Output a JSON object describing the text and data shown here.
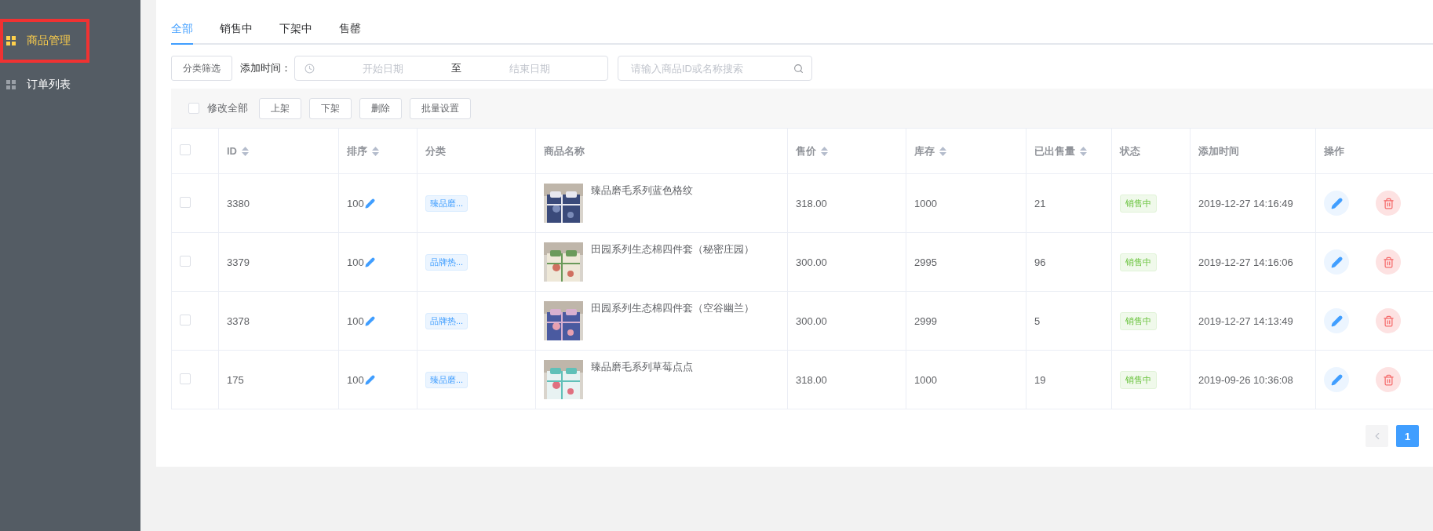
{
  "sidebar": {
    "items": [
      {
        "label": "商品管理",
        "selected": true
      },
      {
        "label": "订单列表",
        "selected": false
      }
    ]
  },
  "tabs": [
    {
      "label": "全部",
      "selected": true
    },
    {
      "label": "销售中",
      "selected": false
    },
    {
      "label": "下架中",
      "selected": false
    },
    {
      "label": "售罄",
      "selected": false
    }
  ],
  "filter": {
    "category_button": "分类筛选",
    "date_label": "添加时间：",
    "start_placeholder": "开始日期",
    "separator": "至",
    "end_placeholder": "结束日期",
    "search_placeholder": "请输入商品ID或名称搜索"
  },
  "bulk_bar": {
    "select_all": {
      "label": "修改全部",
      "checked": false
    },
    "buttons": [
      "上架",
      "下架",
      "删除",
      "批量设置"
    ]
  },
  "table": {
    "header_checked": false,
    "columns": [
      {
        "label": "ID",
        "sortable": true
      },
      {
        "label": "排序",
        "sortable": true
      },
      {
        "label": "分类",
        "sortable": false
      },
      {
        "label": "商品名称",
        "sortable": false
      },
      {
        "label": "售价",
        "sortable": true
      },
      {
        "label": "库存",
        "sortable": true
      },
      {
        "label": "已出售量",
        "sortable": true
      },
      {
        "label": "状态",
        "sortable": false
      },
      {
        "label": "添加时间",
        "sortable": false
      },
      {
        "label": "操作",
        "sortable": false
      }
    ],
    "rows": [
      {
        "checked": false,
        "id": "3380",
        "sort": "100",
        "category": "臻品磨...",
        "name": "臻品磨毛系列蓝色格纹",
        "price": "318.00",
        "stock": "1000",
        "sold": "21",
        "status": "销售中",
        "added": "2019-12-27 14:16:49"
      },
      {
        "checked": false,
        "id": "3379",
        "sort": "100",
        "category": "品牌热...",
        "name": "田园系列生态棉四件套（秘密庄园）",
        "price": "300.00",
        "stock": "2995",
        "sold": "96",
        "status": "销售中",
        "added": "2019-12-27 14:16:06"
      },
      {
        "checked": false,
        "id": "3378",
        "sort": "100",
        "category": "品牌热...",
        "name": "田园系列生态棉四件套（空谷幽兰）",
        "price": "300.00",
        "stock": "2999",
        "sold": "5",
        "status": "销售中",
        "added": "2019-12-27 14:13:49"
      },
      {
        "checked": false,
        "id": "175",
        "sort": "100",
        "category": "臻品磨...",
        "name": "臻品磨毛系列草莓点点",
        "price": "318.00",
        "stock": "1000",
        "sold": "19",
        "status": "销售中",
        "added": "2019-09-26 10:36:08"
      }
    ]
  },
  "pagination": {
    "prev_disabled": true,
    "pages": [
      {
        "label": "1",
        "selected": true
      }
    ]
  }
}
